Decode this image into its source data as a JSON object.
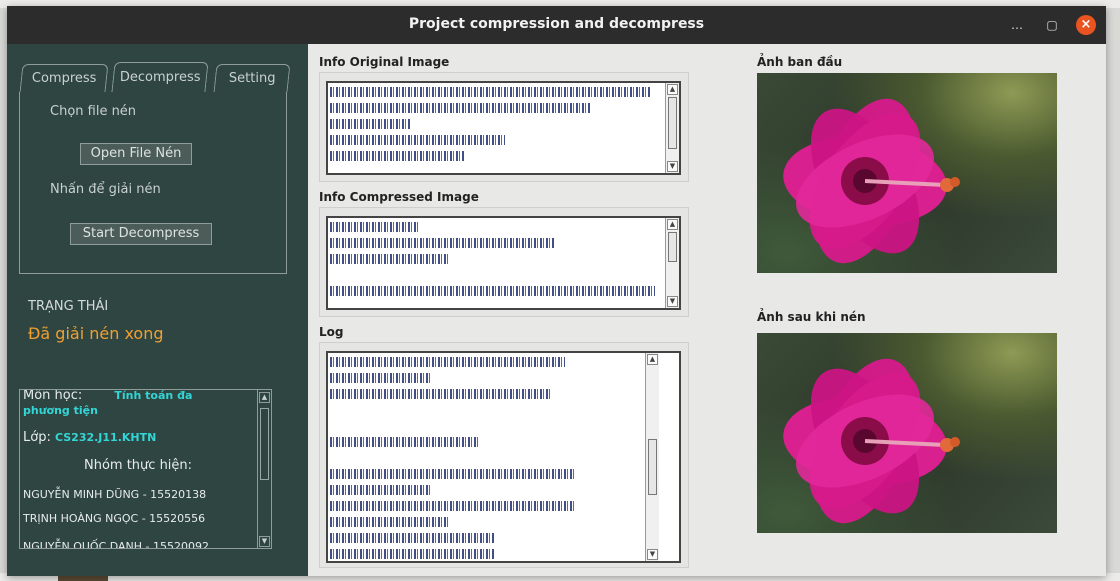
{
  "window": {
    "title": "Project compression and decompress",
    "minimize": "…",
    "maximize": "▢",
    "close": "×"
  },
  "sidebar": {
    "tabs": [
      {
        "label": "Compress"
      },
      {
        "label": "Decompress"
      },
      {
        "label": "Setting"
      }
    ],
    "decompress": {
      "choose_label": "Chọn file nén",
      "open_button": "Open File Nén",
      "press_label": "Nhấn để giải nén",
      "start_button": "Start Decompress"
    },
    "status": {
      "heading": "TRẠNG THÁI",
      "value": "Đã giải nén xong"
    },
    "info": {
      "subject_label": "Môn học:",
      "subject_value_1": "Tính toán đa",
      "subject_value_2": "phương tiện",
      "class_label": "Lớp:",
      "class_value": "CS232.J11.KHTN",
      "group_heading": "Nhóm thực hiện:",
      "members": [
        "NGUYỄN MINH DŨNG - 15520138",
        "TRỊNH HOÀNG NGỌC - 15520556",
        "NGUYỄN QUỐC DANH - 15520092"
      ]
    }
  },
  "center": {
    "original_heading": "Info Original Image",
    "compressed_heading": "Info Compressed Image",
    "log_heading": "Log",
    "log_section_label": "Decompression task"
  },
  "right": {
    "original_caption": "Ảnh ban đầu",
    "after_caption": "Ảnh sau khi nén"
  },
  "colors": {
    "sidebar_bg": "#2f4541",
    "status_accent": "#f0a030",
    "info_accent": "#33d6d6",
    "close_button": "#e95420",
    "flower": "#d8198c"
  }
}
